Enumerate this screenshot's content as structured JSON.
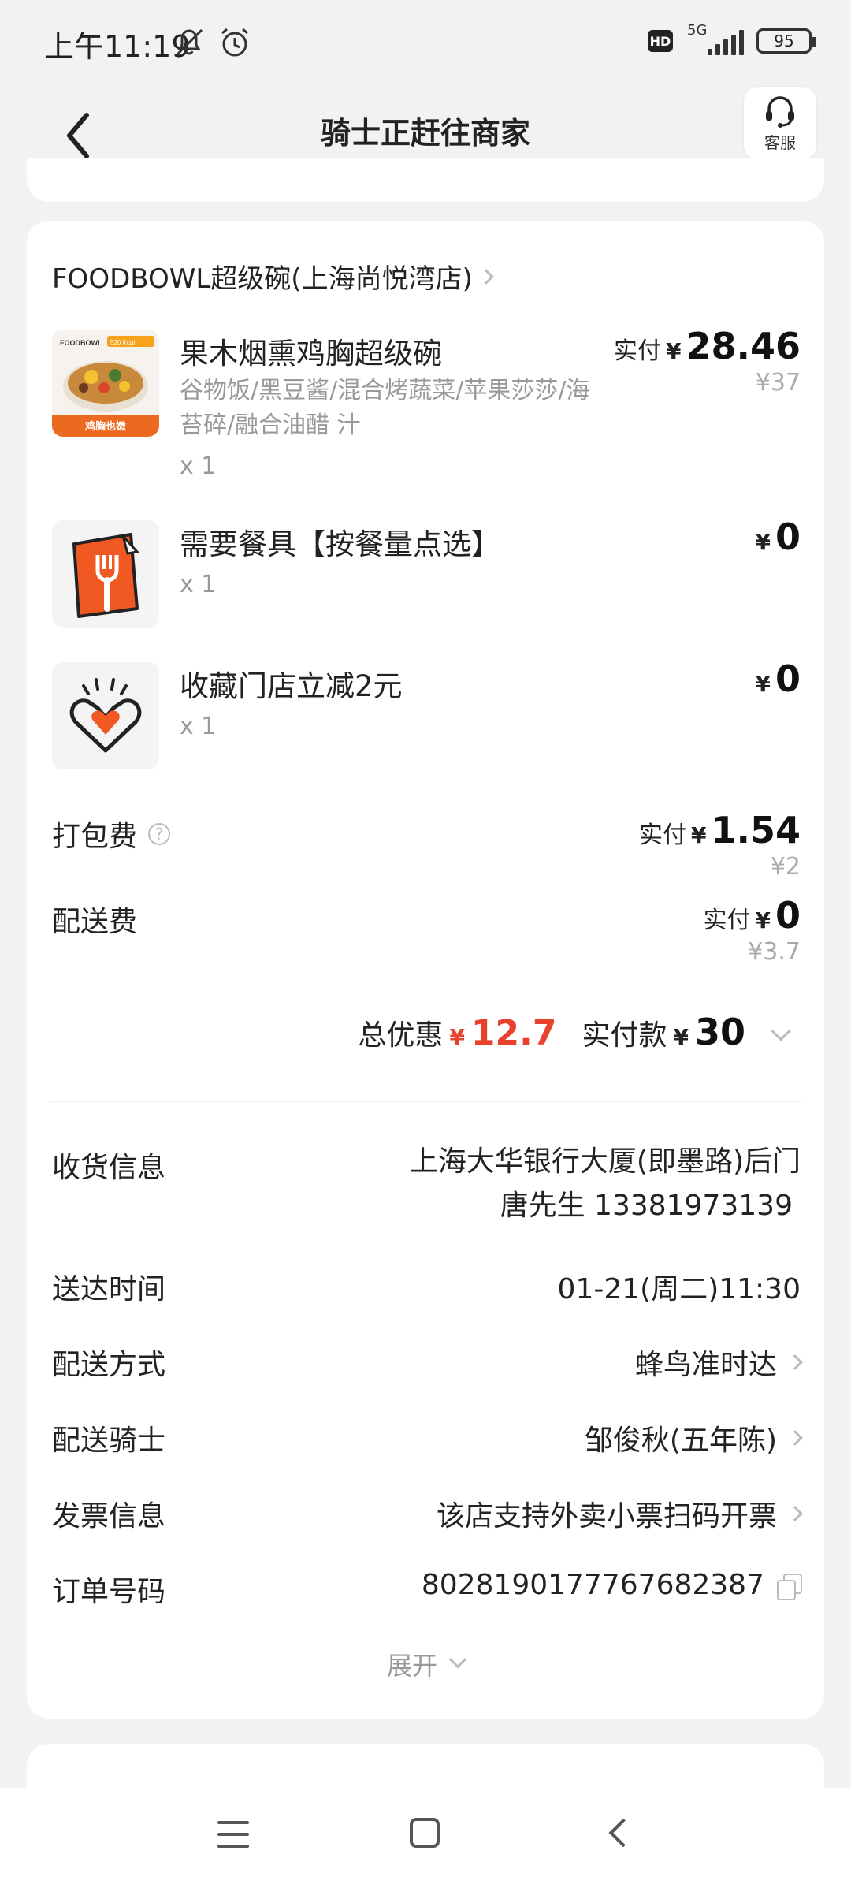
{
  "status_bar": {
    "time": "上午11:19",
    "network": "5G",
    "hd": "HD",
    "battery": "95"
  },
  "header": {
    "title": "骑士正赶往商家",
    "service_label": "客服"
  },
  "store": {
    "name": "FOODBOWL超级碗(上海尚悦湾店)"
  },
  "items": [
    {
      "name": "果木烟熏鸡胸超级碗",
      "desc": "谷物饭/黑豆酱/混合烤蔬菜/苹果莎莎/海苔碎/融合油醋 汁",
      "qty": "x 1",
      "paid_label": "实付",
      "yen": "¥",
      "price": "28.46",
      "orig_price": "¥37",
      "thumb": {
        "brand": "FOODBOWL",
        "kcal": "520 Kcal",
        "caption": "鸡胸也嫩"
      }
    },
    {
      "name": "需要餐具【按餐量点选】",
      "qty": "x 1",
      "yen": "¥",
      "price": "0"
    },
    {
      "name": "收藏门店立减2元",
      "qty": "x 1",
      "yen": "¥",
      "price": "0"
    }
  ],
  "fees": {
    "packing": {
      "label": "打包费",
      "paid_label": "实付",
      "yen": "¥",
      "price": "1.54",
      "orig": "¥2"
    },
    "delivery": {
      "label": "配送费",
      "paid_label": "实付",
      "yen": "¥",
      "price": "0",
      "orig": "¥3.7"
    }
  },
  "summary": {
    "discount_label": "总优惠",
    "yen": "¥",
    "discount": "12.7",
    "paid_label": "实付款",
    "paid": "30"
  },
  "info": {
    "receiver": {
      "label": "收货信息",
      "address": "上海大华银行大厦(即墨路)后门",
      "contact": "唐先生 13381973139"
    },
    "time": {
      "label": "送达时间",
      "value": "01-21(周二)11:30"
    },
    "method": {
      "label": "配送方式",
      "value": "蜂鸟准时达"
    },
    "rider": {
      "label": "配送骑士",
      "value": "邹俊秋(五年陈)"
    },
    "invoice": {
      "label": "发票信息",
      "value": "该店支持外卖小票扫码开票"
    },
    "order": {
      "label": "订单号码",
      "value": "8028190177767682387"
    }
  },
  "expand_label": "展开",
  "colors": {
    "accent_red": "#e8412e",
    "text": "#222222",
    "muted": "#999999",
    "background": "#f2f2f2"
  }
}
